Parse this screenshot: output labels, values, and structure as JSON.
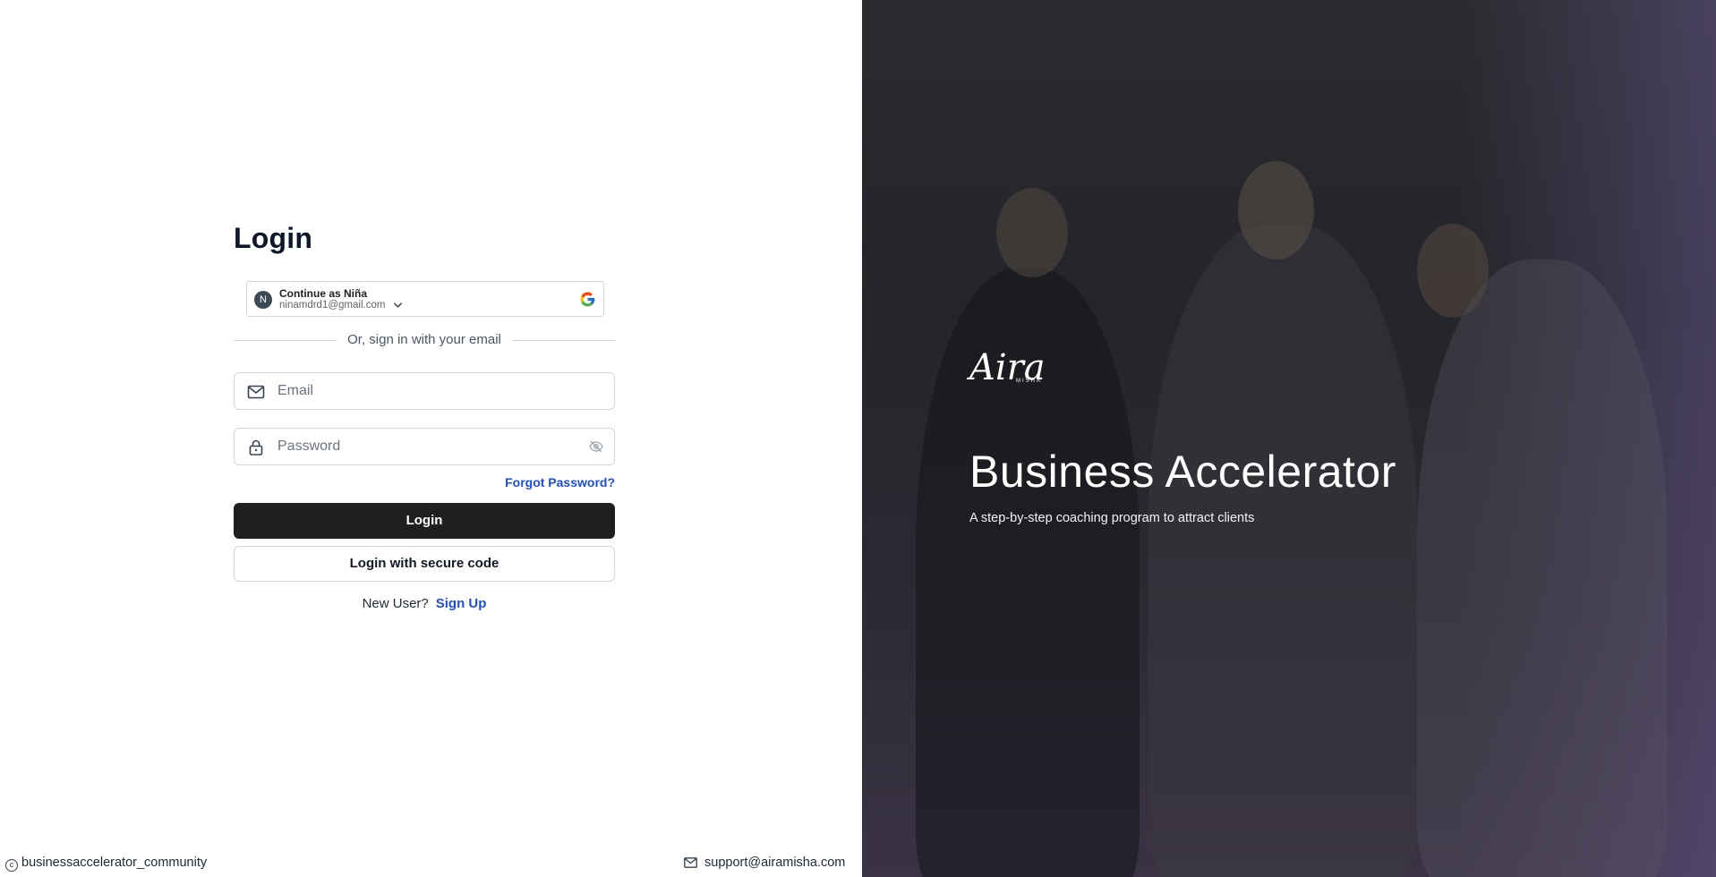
{
  "login": {
    "title": "Login",
    "google": {
      "avatar_letter": "N",
      "name": "Continue as Niña",
      "email": "ninamdrd1@gmail.com"
    },
    "divider_text": "Or, sign in with your email",
    "email_placeholder": "Email",
    "password_placeholder": "Password",
    "forgot_label": "Forgot Password?",
    "login_button": "Login",
    "secure_code_button": "Login with secure code",
    "new_user_text": "New User?",
    "signup_link": "Sign Up"
  },
  "footer": {
    "community": "businessaccelerator_community",
    "support_email": "support@airamisha.com"
  },
  "hero": {
    "logo_text": "Aira",
    "logo_subtext": "MISHA",
    "title": "Business Accelerator",
    "subtitle": "A step-by-step coaching program to attract clients"
  },
  "colors": {
    "primary_button": "#1f1f1f",
    "link": "#1d4ed8",
    "hero_overlay": "#2a2b2f",
    "hero_accent": "#6e5c96"
  },
  "icons": [
    "google-icon",
    "chevron-down-icon",
    "mail-icon",
    "lock-icon",
    "eye-off-icon",
    "copyright-icon"
  ]
}
